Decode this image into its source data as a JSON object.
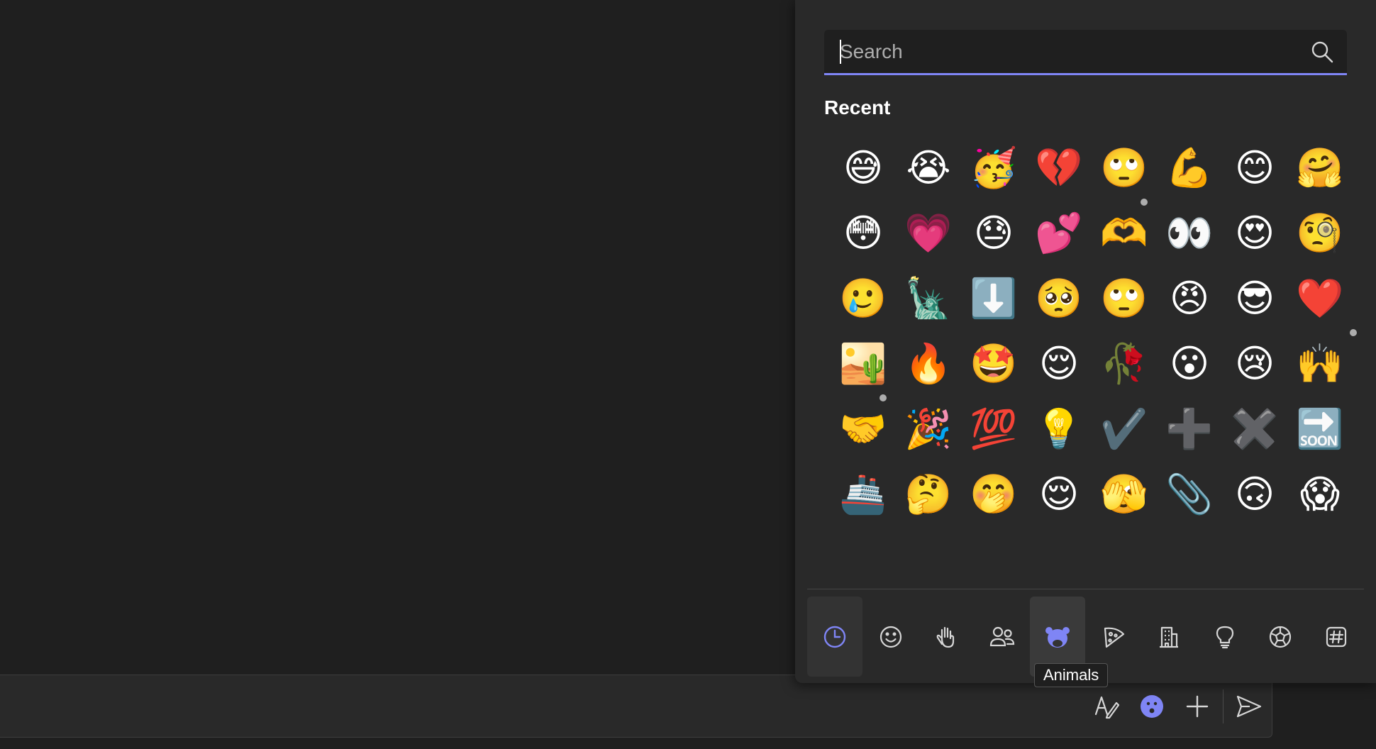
{
  "search": {
    "placeholder": "Search",
    "value": ""
  },
  "recent": {
    "title": "Recent",
    "emojis": [
      "😅",
      "😭",
      "🥳",
      "💔",
      "🙄",
      "💪",
      "😊",
      "🤗",
      "😳",
      "💗",
      "😓",
      "💕",
      "🫶",
      "👀",
      "😍",
      "🧐",
      "🥲",
      "🗽",
      "⬇️",
      "🥺",
      "🙄",
      "😠",
      "😎",
      "❤️",
      "🏜️",
      "🔥",
      "🤩",
      "😌",
      "🥀",
      "😮",
      "😢",
      "🙌",
      "🤝",
      "🎉",
      "💯",
      "💡",
      "✔️",
      "➕",
      "✖️",
      "🔜",
      "🚢",
      "🤔",
      "🤭",
      "😌",
      "🫣",
      "📎",
      "🙃",
      "😱"
    ]
  },
  "categories": [
    {
      "name": "Recent",
      "icon": "clock-icon",
      "active": true
    },
    {
      "name": "Smileys",
      "icon": "smiley-icon"
    },
    {
      "name": "Hands",
      "icon": "hand-icon"
    },
    {
      "name": "People",
      "icon": "people-icon"
    },
    {
      "name": "Animals",
      "icon": "animal-icon",
      "hovered": true
    },
    {
      "name": "Food",
      "icon": "pizza-icon"
    },
    {
      "name": "Places",
      "icon": "building-icon"
    },
    {
      "name": "Objects",
      "icon": "lightbulb-icon"
    },
    {
      "name": "Activities",
      "icon": "soccer-ball-icon"
    },
    {
      "name": "Symbols",
      "icon": "hashtag-icon"
    }
  ],
  "tooltip": {
    "text": "Animals"
  },
  "compose": {
    "actions": [
      "format-icon",
      "emoji-icon",
      "plus-icon",
      "send-icon"
    ]
  },
  "colors": {
    "accent": "#7f85f5",
    "panel": "#292929",
    "background": "#1f1f1f"
  }
}
